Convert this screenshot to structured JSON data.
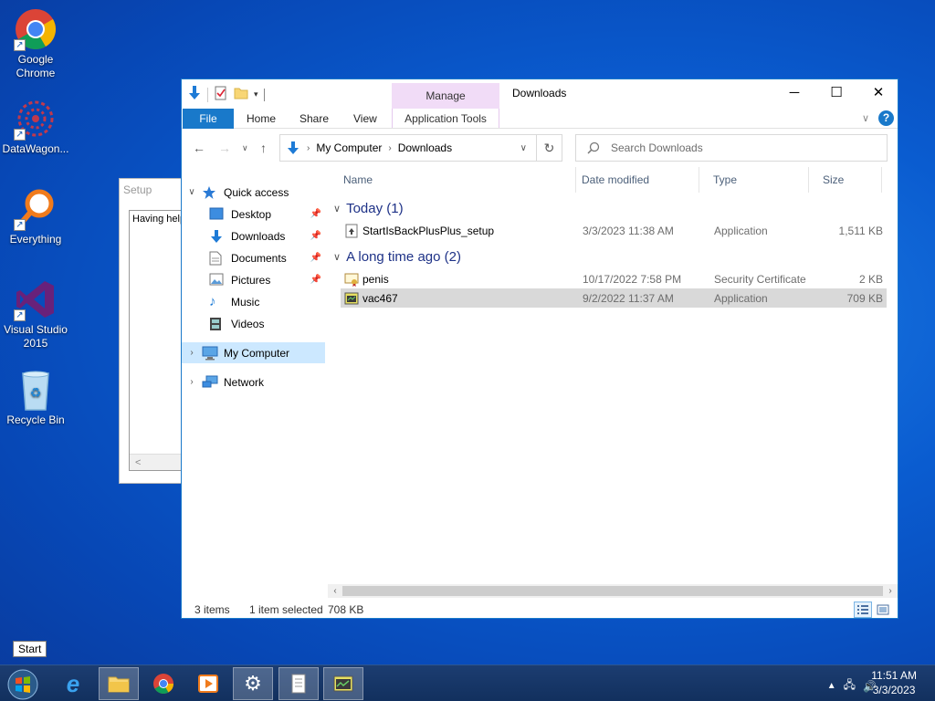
{
  "desktop": {
    "icons": [
      {
        "label_line1": "Google",
        "label_line2": "Chrome"
      },
      {
        "label_line1": "DataWagon...",
        "label_line2": ""
      },
      {
        "label_line1": "Everything",
        "label_line2": ""
      },
      {
        "label_line1": "Visual Studio",
        "label_line2": "2015"
      },
      {
        "label_line1": "Recycle Bin",
        "label_line2": ""
      }
    ]
  },
  "setup_window": {
    "title": "Setup",
    "body_text": "Having help",
    "scroll_left": "<"
  },
  "explorer": {
    "title": "Downloads",
    "manage_label": "Manage",
    "app_tools_label": "Application Tools",
    "tabs": {
      "file": "File",
      "home": "Home",
      "share": "Share",
      "view": "View"
    },
    "address": {
      "crumb1": "My Computer",
      "crumb2": "Downloads"
    },
    "search_placeholder": "Search Downloads",
    "nav": {
      "quick_access": "Quick access",
      "desktop": "Desktop",
      "downloads": "Downloads",
      "documents": "Documents",
      "pictures": "Pictures",
      "music": "Music",
      "videos": "Videos",
      "my_computer": "My Computer",
      "network": "Network"
    },
    "columns": {
      "name": "Name",
      "date": "Date modified",
      "type": "Type",
      "size": "Size"
    },
    "groups": [
      {
        "label": "Today (1)"
      },
      {
        "label": "A long time ago (2)"
      }
    ],
    "files": [
      {
        "name": "StartIsBackPlusPlus_setup",
        "date": "3/3/2023 11:38 AM",
        "type": "Application",
        "size": "1,511 KB"
      },
      {
        "name": "penis",
        "date": "10/17/2022 7:58 PM",
        "type": "Security Certificate",
        "size": "2 KB"
      },
      {
        "name": "vac467",
        "date": "9/2/2022 11:37 AM",
        "type": "Application",
        "size": "709 KB"
      }
    ],
    "status": {
      "items": "3 items",
      "selected": "1 item selected",
      "selected_size": "708 KB"
    }
  },
  "taskbar": {
    "start_tooltip": "Start",
    "clock_time": "11:51 AM",
    "clock_date": "3/3/2023"
  },
  "colors": {
    "accent": "#1979ca",
    "selection": "#cce8ff",
    "manage_tab": "#f1dcf7"
  }
}
